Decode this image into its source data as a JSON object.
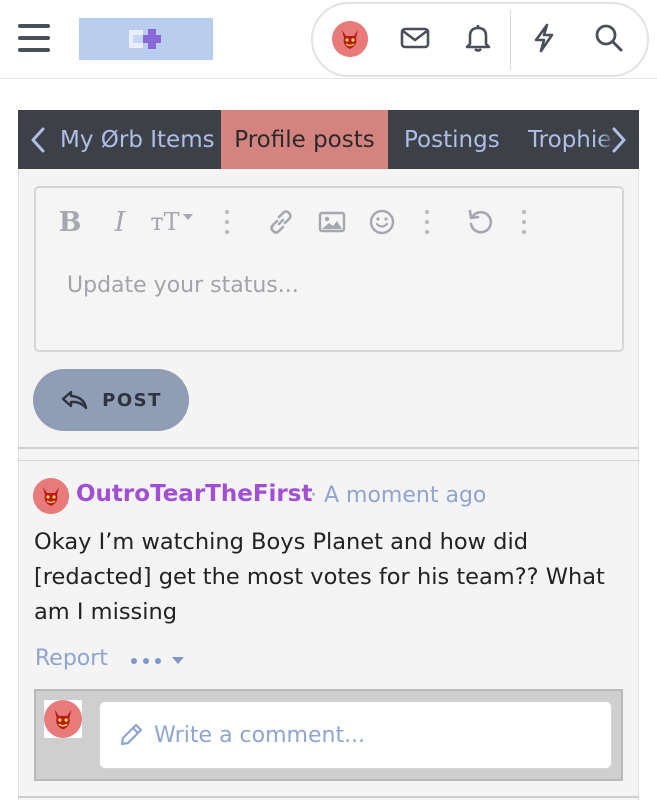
{
  "header": {
    "menu_icon": "hamburger-menu-icon",
    "logo_icon": "site-logo",
    "icons": [
      "user-avatar",
      "mail-icon",
      "bell-icon",
      "lightning-icon",
      "search-icon"
    ]
  },
  "tabs": {
    "items": [
      {
        "label": "My Ørb Items"
      },
      {
        "label": "Profile posts"
      },
      {
        "label": "Postings"
      },
      {
        "label": "Trophies"
      }
    ],
    "active_index": 1
  },
  "editor": {
    "placeholder": "Update your status...",
    "toolbar": {
      "bold": "B",
      "italic": "I",
      "text_size": "тT",
      "tools": [
        "bold-icon",
        "italic-icon",
        "text-size-icon",
        "link-icon",
        "image-icon",
        "smiley-icon",
        "undo-icon"
      ]
    },
    "post_label": "POST"
  },
  "post": {
    "author": "OutroTearTheFirst",
    "separator": "·",
    "time": "A moment ago",
    "lines": [
      "Okay I’m watching Boys Planet and how did",
      "[redacted] get the most votes for his team?? What",
      "am I missing"
    ],
    "report_label": "Report",
    "comment_placeholder": "Write a comment..."
  },
  "colors": {
    "tab_bar": "#3e4048",
    "tab_active": "#d5837f",
    "tab_text": "#aebfe6",
    "author": "#a24fd4",
    "link": "#8fa5cf",
    "post_button": "#8f9db5",
    "avatar": "#e87a7a"
  }
}
